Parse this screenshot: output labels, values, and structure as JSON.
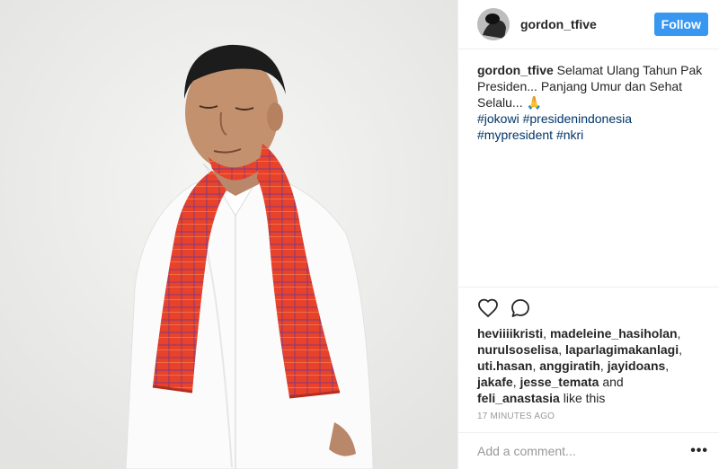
{
  "photo": {
    "alt_subject": "portrait",
    "background_color": "#efefed",
    "scarf_color": "#e8432a"
  },
  "header": {
    "username": "gordon_tfive",
    "follow_label": "Follow",
    "follow_color": "#3897f0"
  },
  "caption": {
    "username": "gordon_tfive",
    "text": " Selamat Ulang Tahun Pak Presiden... Panjang Umur dan Sehat Selalu... 🙏",
    "hashtags": [
      "#jokowi",
      "#presidenindonesia",
      "#mypresident",
      "#nkri"
    ],
    "hashtag_color": "#003569"
  },
  "actions": {
    "like_icon": "heart-icon",
    "comment_icon": "comment-icon"
  },
  "likes": {
    "users": [
      "heviiiikristi",
      "madeleine_hasiholan",
      "nurulsoselisa",
      "laparlagimakanlagi",
      "uti.hasan",
      "anggiratih",
      "jayidoans",
      "jakafe",
      "jesse_temata"
    ],
    "and_text": "and",
    "last_user": "feli_anastasia",
    "suffix": "like this"
  },
  "timestamp": "17 MINUTES AGO",
  "comment": {
    "placeholder": "Add a comment...",
    "more_label": "•••"
  }
}
